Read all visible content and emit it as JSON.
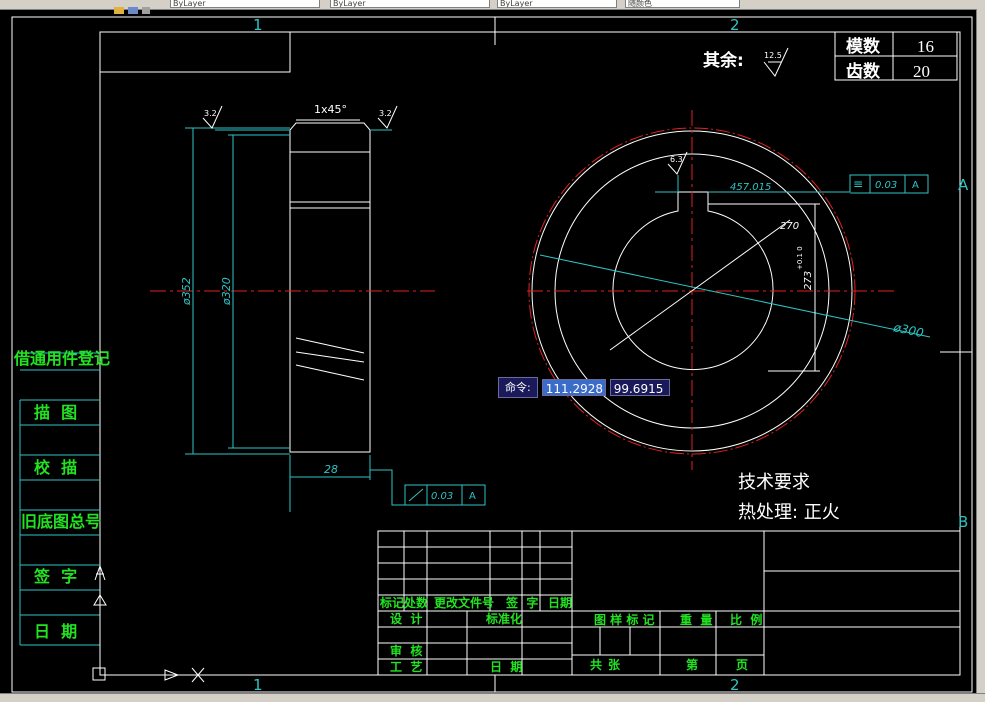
{
  "toolbar": {
    "layer_field_1": "ByLayer",
    "layer_field_2": "ByLayer",
    "layer_field_3": "ByLayer",
    "color_field": "随颜色"
  },
  "frame": {
    "zone_top_1": "1",
    "zone_top_2": "2",
    "zone_bottom_1": "1",
    "zone_bottom_2": "2",
    "zone_right_a": "A",
    "zone_right_b": "B"
  },
  "gear_table": {
    "module_label": "模数",
    "module_value": "16",
    "teeth_label": "齿数",
    "teeth_value": "20"
  },
  "roughness_note": {
    "label": "其余:",
    "value": "12.5"
  },
  "side_view": {
    "chamfer": "1x45°",
    "roughness_left": "3.2",
    "roughness_right": "3.2",
    "dia_outer": "ø352",
    "dia_pitch": "ø320",
    "width": "28",
    "runout_value": "0.03",
    "runout_datum": "A"
  },
  "front_view": {
    "roughness_keyway": "6.3",
    "keyway_width": "457.015",
    "bore_dia": "270",
    "keyway_depth": "273",
    "keyway_tol": "+0.1 0",
    "outer_dia": "ø300",
    "symmetry_value": "0.03",
    "symmetry_datum": "A"
  },
  "tech_requirements": {
    "title": "技术要求",
    "heat_treatment": "热处理: 正火"
  },
  "left_stamp": {
    "row1": "借通用件登记",
    "row2": "描  图",
    "row3": "校  描",
    "row4": "旧底图总号",
    "row5": "签  字",
    "row6": "日  期"
  },
  "title_block": {
    "mark": "标记",
    "count": "处数",
    "change_doc": "更改文件号",
    "signature": "签  字",
    "date": "日期",
    "design": "设  计",
    "standardize": "标准化",
    "review": "审  核",
    "process": "工  艺",
    "date2": "日  期",
    "drawing_mark": "图 样 标 记",
    "weight": "重  量",
    "scale": "比  例",
    "total": "共",
    "sheets": "张",
    "page_of": "第",
    "page": "页"
  },
  "command": {
    "label": "命令:",
    "x_value": "111.2928",
    "y_value": "99.6915"
  }
}
